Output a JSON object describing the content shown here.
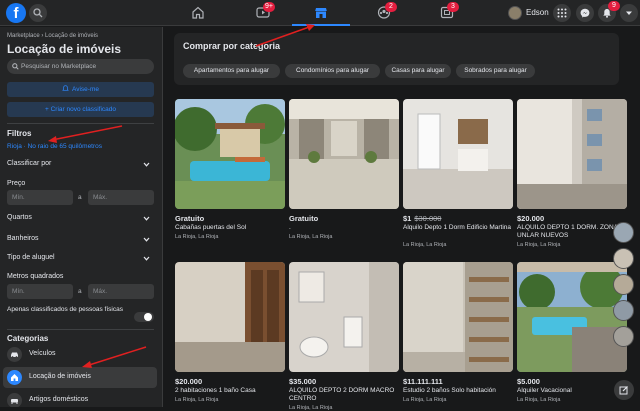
{
  "topbar": {
    "logo": "f",
    "badges": {
      "watch": "9+",
      "groups": "2",
      "gaming": "3",
      "notifications": "9"
    },
    "profile_name": "Edson"
  },
  "sidebar": {
    "breadcrumb": "Marketplace › Locação de imóveis",
    "title": "Locação de imóveis",
    "search_placeholder": "Pesquisar no Marketplace",
    "alert_button": "Avise-me",
    "create_button": "+ Criar novo classificado",
    "filters_title": "Filtros",
    "location_link": "Rioja · No raio de 65 quilômetros",
    "filters": {
      "sort": "Classificar por",
      "price": "Preço",
      "price_min": "Mín.",
      "price_max": "Máx.",
      "a": "a",
      "rooms": "Quartos",
      "bathrooms": "Banheiros",
      "rental_type": "Tipo de aluguel",
      "sqm": "Metros quadrados",
      "sqm_min": "Mín.",
      "sqm_max": "Máx.",
      "sellers_only": "Apenas classificados de pessoas físicas"
    },
    "categories_title": "Categorias",
    "categories": [
      {
        "label": "Veículos",
        "icon": "car-icon"
      },
      {
        "label": "Locação de imóveis",
        "icon": "house-icon",
        "active": true
      },
      {
        "label": "Artigos domésticos",
        "icon": "sofa-icon"
      }
    ]
  },
  "main": {
    "category_title": "Comprar por categoria",
    "chips": [
      "Apartamentos para alugar",
      "Condomínios para alugar",
      "Casas para alugar",
      "Sobrados para alugar"
    ],
    "listings": [
      {
        "price": "Gratuito",
        "old_price": "",
        "title": "Cabañas puertas del Sol",
        "location": "La Rioja, La Rioja"
      },
      {
        "price": "Gratuito",
        "old_price": "",
        "title": ".",
        "location": "La Rioja, La Rioja"
      },
      {
        "price": "$1",
        "old_price": "$30.000",
        "title": "Alquilo Depto 1 Dorm Edificio Martina",
        "location": "La Rioja, La Rioja"
      },
      {
        "price": "$20.000",
        "old_price": "",
        "title": "ALQUILO DEPTO 1 DORM. ZONA UNLAR NUEVOS",
        "location": "La Rioja, La Rioja"
      },
      {
        "price": "$20.000",
        "old_price": "",
        "title": "2 habitaciones 1 baño Casa",
        "location": "La Rioja, La Rioja"
      },
      {
        "price": "$35.000",
        "old_price": "",
        "title": "ALQUILO DEPTO 2 DORM MACRO CENTRO",
        "location": "La Rioja, La Rioja"
      },
      {
        "price": "$11.111.111",
        "old_price": "",
        "title": "Estudio 2 baños Solo habitación",
        "location": "La Rioja, La Rioja"
      },
      {
        "price": "$5.000",
        "old_price": "",
        "title": "Alquiler Vacacional",
        "location": "La Rioja, La Rioja"
      }
    ]
  },
  "colors": {
    "accent": "#2d88ff",
    "badge": "#e41e3f",
    "annotation_arrow": "#e02020"
  }
}
